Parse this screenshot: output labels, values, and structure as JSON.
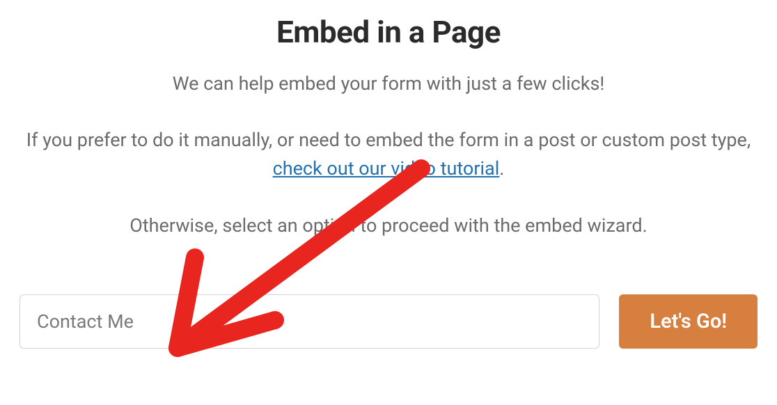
{
  "modal": {
    "title": "Embed in a Page",
    "subtitle": "We can help embed your form with just a few clicks!",
    "description_prefix": "If you prefer to do it manually, or need to embed the form in a post or custom post type, ",
    "link_text": "check out our video tutorial",
    "description_suffix": ".",
    "instruction": "Otherwise, select an option to proceed with the embed wizard.",
    "select_value": "Contact Me",
    "button_label": "Let's Go!"
  }
}
